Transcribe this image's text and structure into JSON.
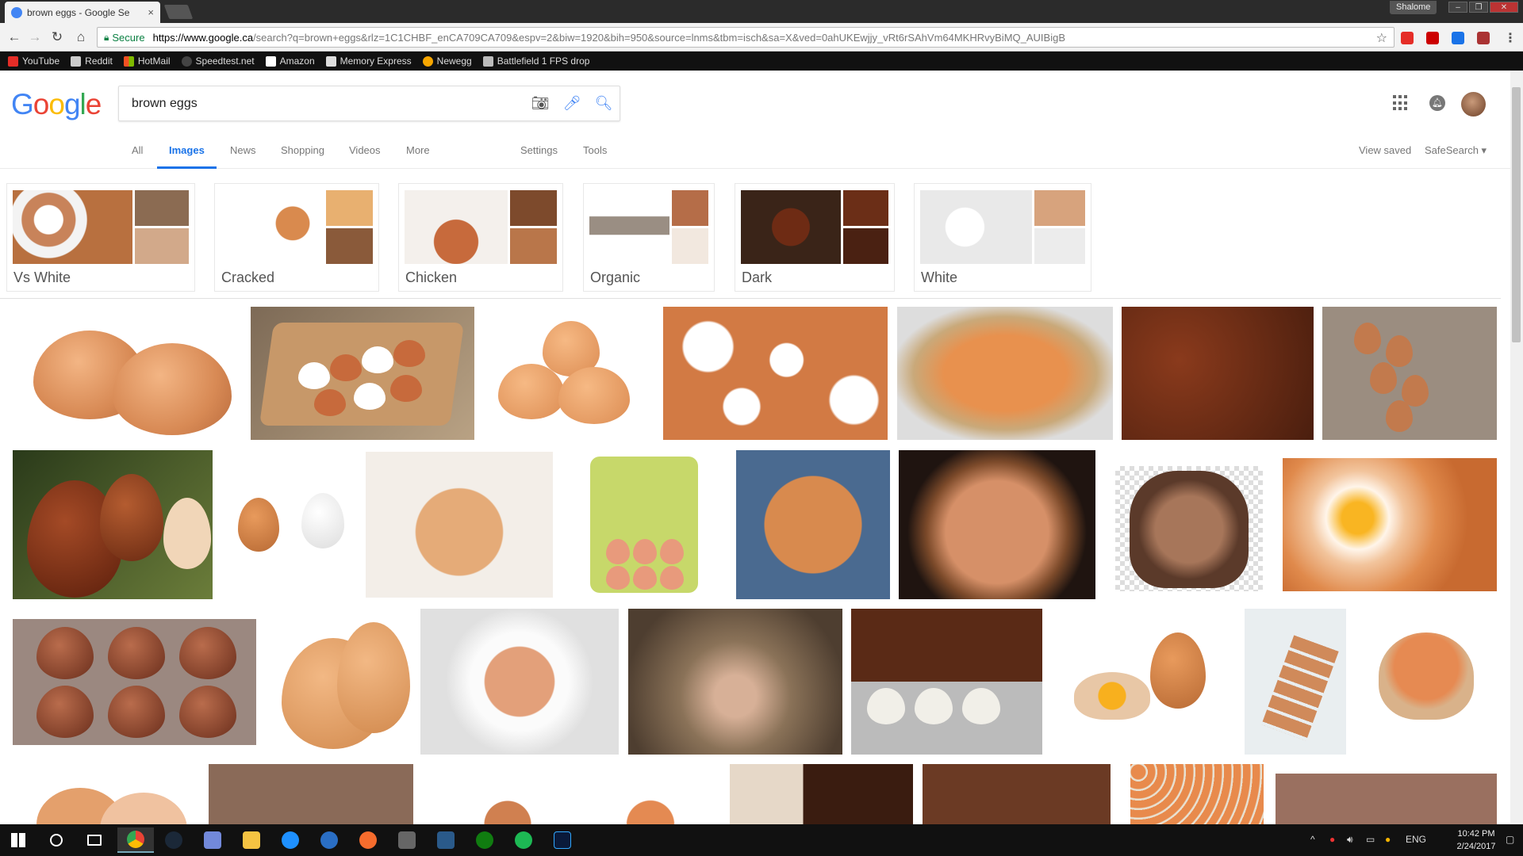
{
  "browser": {
    "tab_title": "brown eggs - Google Se",
    "user": "Shalome",
    "secure_label": "Secure",
    "url_host": "https://www.google.ca",
    "url_rest": "/search?q=brown+eggs&rlz=1C1CHBF_enCA709CA709&espv=2&biw=1920&bih=950&source=lnms&tbm=isch&sa=X&ved=0ahUKEwjjy_vRt6rSAhVm64MKHRvyBiMQ_AUIBigB"
  },
  "bookmarks": [
    {
      "label": "YouTube",
      "color": "#e52d27"
    },
    {
      "label": "Reddit",
      "color": "#cccccc"
    },
    {
      "label": "HotMail",
      "color": "#f25022"
    },
    {
      "label": "Speedtest.net",
      "color": "#444444"
    },
    {
      "label": "Amazon",
      "color": "#ffffff"
    },
    {
      "label": "Memory Express",
      "color": "#dddddd"
    },
    {
      "label": "Newegg",
      "color": "#f7a600"
    },
    {
      "label": "Battlefield 1 FPS drop",
      "color": "#bbbbbb"
    }
  ],
  "search": {
    "query": "brown eggs"
  },
  "nav": {
    "all": "All",
    "images": "Images",
    "news": "News",
    "shopping": "Shopping",
    "videos": "Videos",
    "more": "More",
    "settings": "Settings",
    "tools": "Tools",
    "view_saved": "View saved",
    "safesearch": "SafeSearch ▾"
  },
  "related": [
    {
      "label": "Vs White"
    },
    {
      "label": "Cracked"
    },
    {
      "label": "Chicken"
    },
    {
      "label": "Organic"
    },
    {
      "label": "Dark"
    },
    {
      "label": "White"
    }
  ],
  "taskbar": {
    "time": "10:42 PM",
    "date": "2/24/2017",
    "lang": "ENG"
  }
}
